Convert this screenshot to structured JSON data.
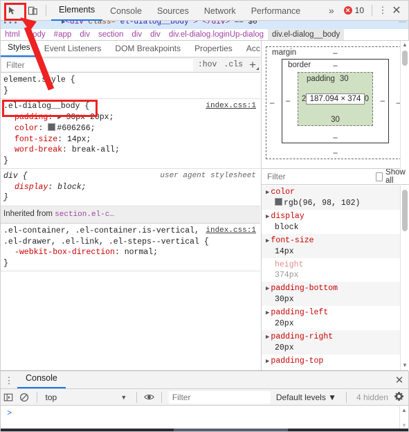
{
  "toolbar": {
    "inspect_icon": "inspect-cursor-icon",
    "device_icon": "device-toolbar-icon",
    "tabs": [
      {
        "label": "Elements",
        "active": true
      },
      {
        "label": "Console",
        "active": false
      },
      {
        "label": "Sources",
        "active": false
      },
      {
        "label": "Network",
        "active": false
      },
      {
        "label": "Performance",
        "active": false
      }
    ],
    "more_tabs": "»",
    "error_glyph": "✕",
    "error_count": "10",
    "kebab": "⋮",
    "close": "✕"
  },
  "dom_strip": {
    "ellipsis": "•••",
    "arrow": "▶",
    "tag_open": "<div",
    "attr_name": " class=",
    "attr_value": "\"el-dialog__body\"",
    "tag_close": "> </div>",
    "selected_marker": "== $0",
    "right_marker": "—–"
  },
  "breadcrumbs": [
    {
      "label": "html",
      "selected": false
    },
    {
      "label": "body",
      "selected": false
    },
    {
      "label": "#app",
      "selected": false
    },
    {
      "label": "div",
      "selected": false
    },
    {
      "label": "section",
      "selected": false
    },
    {
      "label": "div",
      "selected": false
    },
    {
      "label": "div",
      "selected": false
    },
    {
      "label": "div.el-dialog.loginUp-dialog",
      "selected": false
    },
    {
      "label": "div.el-dialog__body",
      "selected": true
    }
  ],
  "styles_tabs": [
    {
      "label": "Styles",
      "active": true
    },
    {
      "label": "Event Listeners",
      "active": false
    },
    {
      "label": "DOM Breakpoints",
      "active": false
    },
    {
      "label": "Properties",
      "active": false
    },
    {
      "label": "Accessibility",
      "active": false
    }
  ],
  "styles_filter": {
    "placeholder": "Filter",
    "hov": ":hov",
    "cls": ".cls",
    "plus": "+"
  },
  "rules": [
    {
      "selector": "element.style {",
      "source": "",
      "source_link": false,
      "declarations": [],
      "close": "}"
    },
    {
      "selector": ".el-dialog__body {",
      "source": "index.css:1",
      "source_link": true,
      "declarations": [
        {
          "name": "padding",
          "value": "30px 20px;",
          "expandable": true,
          "swatch": false
        },
        {
          "name": "color",
          "value": "#606266;",
          "expandable": false,
          "swatch": true
        },
        {
          "name": "font-size",
          "value": "14px;",
          "expandable": false,
          "swatch": false
        },
        {
          "name": "word-break",
          "value": "break-all;",
          "expandable": false,
          "swatch": false
        }
      ],
      "close": "}"
    },
    {
      "selector": "div {",
      "source": "user agent stylesheet",
      "source_link": false,
      "italic": true,
      "declarations": [
        {
          "name": "display",
          "value": "block;",
          "expandable": false,
          "swatch": false
        }
      ],
      "close": "}"
    }
  ],
  "inherited": {
    "prefix": "Inherited from ",
    "selector": "section.el-c…"
  },
  "inherited_rule": {
    "selector_line1": ".el-container, .el-container.is-vertical,",
    "selector_line2": ".el-drawer, .el-link, .el-steps--vertical {",
    "source": "index.css:1",
    "declarations": [
      {
        "name": "-webkit-box-direction",
        "value": "normal;"
      }
    ],
    "close": "}"
  },
  "box_model": {
    "margin_label": "margin",
    "border_label": "border",
    "padding_label": "padding",
    "content_size": "187.094 × 374",
    "margin_top": "–",
    "margin_right": "–",
    "margin_bottom": "–",
    "margin_left": "–",
    "border_top": "–",
    "border_right": "–",
    "border_bottom": "–",
    "border_left": "–",
    "padding_top": "30",
    "padding_right": "20",
    "padding_bottom": "30",
    "padding_left": "20"
  },
  "computed_filter": {
    "placeholder": "Filter",
    "show_all_label": "Show all"
  },
  "computed": [
    {
      "name": "color",
      "value": "rgb(96, 98, 102)",
      "swatch": true,
      "dim": false
    },
    {
      "name": "display",
      "value": "block",
      "swatch": false,
      "dim": false
    },
    {
      "name": "font-size",
      "value": "14px",
      "swatch": false,
      "dim": false
    },
    {
      "name": "height",
      "value": "374px",
      "swatch": false,
      "dim": true
    },
    {
      "name": "padding-bottom",
      "value": "30px",
      "swatch": false,
      "dim": false
    },
    {
      "name": "padding-left",
      "value": "20px",
      "swatch": false,
      "dim": false
    },
    {
      "name": "padding-right",
      "value": "20px",
      "swatch": false,
      "dim": false
    },
    {
      "name": "padding-top",
      "value": "",
      "swatch": false,
      "dim": false
    }
  ],
  "drawer": {
    "kebab": "⋮",
    "tab_label": "Console",
    "close": "✕",
    "sidebar_icon": "console-sidebar-icon",
    "clear_icon": "clear-console-icon",
    "context": "top",
    "context_caret": "▼",
    "eye_icon": "live-expression-icon",
    "filter_placeholder": "Filter",
    "levels": "Default levels ▼",
    "hidden_count": "4 hidden",
    "gear_icon": "settings-gear-icon",
    "prompt": ">"
  },
  "colors": {
    "accent": "#1a73e8",
    "error": "#e53935",
    "annotation": "#ee2222",
    "property": "#c80000",
    "selector": "#a144a1",
    "padding_box": "#cfe0c3",
    "dom_highlight": "#d8e8fb"
  }
}
